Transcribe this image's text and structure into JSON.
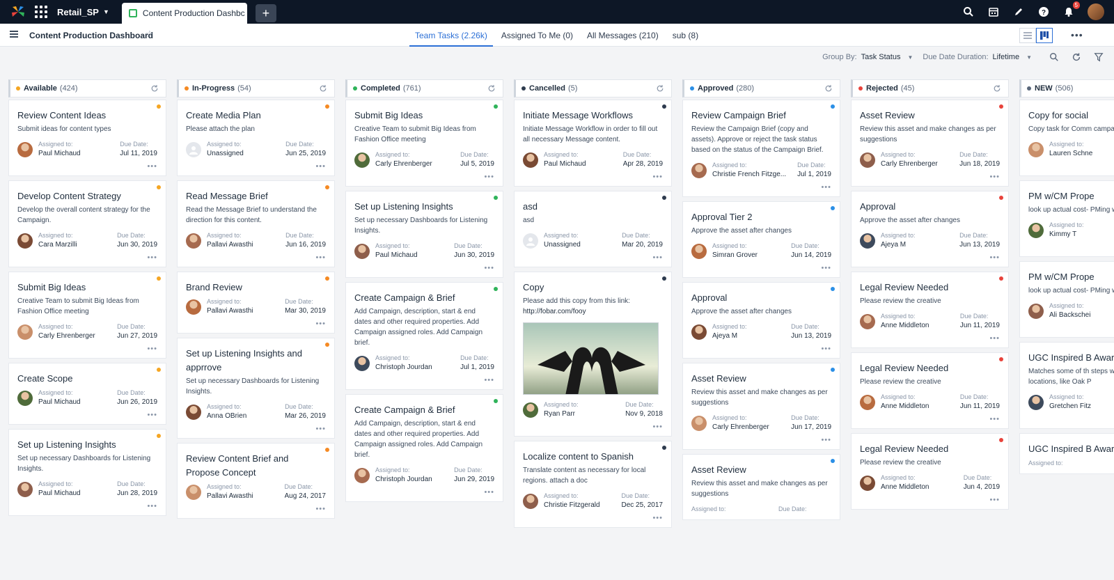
{
  "topbar": {
    "workspace": "Retail_SP",
    "active_tab": "Content Production Dashbc",
    "notification_count": "5",
    "icons": [
      "search-icon",
      "calendar-icon",
      "pencil-icon",
      "help-icon",
      "bell-icon"
    ]
  },
  "header": {
    "title": "Content Production Dashboard",
    "tabs": [
      "Team Tasks (2.26k)",
      "Assigned To Me (0)",
      "All Messages (210)",
      "sub (8)"
    ]
  },
  "filters": {
    "group_label": "Group By:",
    "group_value": "Task Status",
    "duration_label": "Due Date Duration:",
    "duration_value": "Lifetime"
  },
  "labels": {
    "assigned": "Assigned to:",
    "due": "Due Date:"
  },
  "colors": {
    "available": "#f5a623",
    "in_progress": "#f58a23",
    "completed": "#2fb35a",
    "cancelled": "#2e3b4e",
    "approved": "#2b8fe6",
    "rejected": "#e8433b",
    "new": "#5a677a"
  },
  "columns": [
    {
      "name": "Available",
      "count": "(424)",
      "color": "#f5a623",
      "cards": [
        {
          "title": "Review Content Ideas",
          "desc": "Submit ideas for content types",
          "assignee": "Paul Michaud",
          "due": "Jul 11, 2019"
        },
        {
          "title": "Develop Content Strategy",
          "desc": "Develop the overall content strategy for the Campaign.",
          "assignee": "Cara Marzilli",
          "due": "Jun 30, 2019"
        },
        {
          "title": "Submit Big Ideas",
          "desc": "Creative Team to submit Big Ideas from Fashion Office meeting",
          "assignee": "Carly Ehrenberger",
          "due": "Jun 27, 2019"
        },
        {
          "title": "Create Scope",
          "desc": "",
          "assignee": "Paul Michaud",
          "due": "Jun 26, 2019"
        },
        {
          "title": "Set up Listening Insights",
          "desc": "Set up necessary Dashboards for Listening Insights.",
          "assignee": "Paul Michaud",
          "due": "Jun 28, 2019"
        }
      ]
    },
    {
      "name": "In-Progress",
      "count": "(54)",
      "color": "#f58a23",
      "cards": [
        {
          "title": "Create Media Plan",
          "desc": "Please attach the plan",
          "assignee": "Unassigned",
          "due": "Jun 25, 2019"
        },
        {
          "title": "Read Message Brief",
          "desc": "Read the Message Brief to understand the direction for this content.",
          "assignee": "Pallavi Awasthi",
          "due": "Jun 16, 2019"
        },
        {
          "title": "Brand Review",
          "desc": "",
          "assignee": "Pallavi Awasthi",
          "due": "Mar 30, 2019"
        },
        {
          "title": "Set up Listening Insights and apprrove",
          "desc": "Set up necessary Dashboards for Listening Insights.",
          "assignee": "Anna OBrien",
          "due": "Mar 26, 2019"
        },
        {
          "title": "Review Content Brief and Propose Concept",
          "desc": "",
          "assignee": "Pallavi Awasthi",
          "due": "Aug 24, 2017"
        }
      ]
    },
    {
      "name": "Completed",
      "count": "(761)",
      "color": "#2fb35a",
      "cards": [
        {
          "title": "Submit Big Ideas",
          "desc": "Creative Team to submit Big Ideas from Fashion Office meeting",
          "assignee": "Carly Ehrenberger",
          "due": "Jul 5, 2019"
        },
        {
          "title": "Set up Listening Insights",
          "desc": "Set up necessary Dashboards for Listening Insights.",
          "assignee": "Paul Michaud",
          "due": "Jun 30, 2019"
        },
        {
          "title": "Create Campaign & Brief",
          "desc": "Add Campaign, description, start & end dates and other required properties. Add Campaign assigned roles. Add Campaign brief.",
          "assignee": "Christoph Jourdan",
          "due": "Jul 1, 2019"
        },
        {
          "title": "Create Campaign & Brief",
          "desc": "Add Campaign, description, start & end dates and other required properties. Add Campaign assigned roles. Add Campaign brief.",
          "assignee": "Christoph Jourdan",
          "due": "Jun 29, 2019"
        }
      ]
    },
    {
      "name": "Cancelled",
      "count": "(5)",
      "color": "#2e3b4e",
      "cards": [
        {
          "title": "Initiate Message Workflows",
          "desc": "Initiate Message Workflow in order to fill out all necessary Message content.",
          "assignee": "Paul Michaud",
          "due": "Apr 28, 2019"
        },
        {
          "title": "asd",
          "desc": "asd",
          "assignee": "Unassigned",
          "due": "Mar 20, 2019"
        },
        {
          "title": "Copy",
          "desc": "Please add this copy from this link:",
          "link": "http://fobar.com/fooy",
          "image": true,
          "assignee": "Ryan Parr",
          "due": "Nov 9, 2018"
        },
        {
          "title": "Localize content to Spanish",
          "desc": "Translate content as necessary for local regions. attach a doc",
          "assignee": "Christie Fitzgerald",
          "due": "Dec 25, 2017"
        }
      ]
    },
    {
      "name": "Approved",
      "count": "(280)",
      "color": "#2b8fe6",
      "cards": [
        {
          "title": "Review Campaign Brief",
          "desc": "Review the Campaign Brief (copy and assets). Approve or reject the task status based on the status of the Campaign Brief.",
          "assignee": "Christie French Fitzge...",
          "due": "Jul 1, 2019"
        },
        {
          "title": "Approval Tier 2",
          "desc": "Approve the asset after changes",
          "assignee": "Simran Grover",
          "due": "Jun 14, 2019"
        },
        {
          "title": "Approval",
          "desc": "Approve the asset after changes",
          "assignee": "Ajeya M",
          "due": "Jun 13, 2019"
        },
        {
          "title": "Asset Review",
          "desc": "Review this asset and make changes as per suggestions",
          "assignee": "Carly Ehrenberger",
          "due": "Jun 17, 2019"
        },
        {
          "title": "Asset Review",
          "desc": "Review this asset and make changes as per suggestions",
          "assignee": "",
          "due": ""
        }
      ]
    },
    {
      "name": "Rejected",
      "count": "(45)",
      "color": "#e8433b",
      "cards": [
        {
          "title": "Asset Review",
          "desc": "Review this asset and make changes as per suggestions",
          "assignee": "Carly Ehrenberger",
          "due": "Jun 18, 2019"
        },
        {
          "title": "Approval",
          "desc": "Approve the asset after changes",
          "assignee": "Ajeya M",
          "due": "Jun 13, 2019"
        },
        {
          "title": "Legal Review Needed",
          "desc": "Please review the creative",
          "assignee": "Anne Middleton",
          "due": "Jun 11, 2019"
        },
        {
          "title": "Legal Review Needed",
          "desc": "Please review the creative",
          "assignee": "Anne Middleton",
          "due": "Jun 11, 2019"
        },
        {
          "title": "Legal Review Needed",
          "desc": "Please review the creative",
          "assignee": "Anne Middleton",
          "due": "Jun 4, 2019"
        }
      ]
    },
    {
      "name": "NEW",
      "count": "(506)",
      "color": "#5a677a",
      "cards": [
        {
          "title": "Copy for social",
          "desc": "Copy task for Comm campaign",
          "assignee": "Lauren Schne",
          "due": ""
        },
        {
          "title": "PM w/CM Prope",
          "desc": "look up actual cost- PMing with CM",
          "assignee": "Kimmy T",
          "due": ""
        },
        {
          "title": "PM w/CM Prope",
          "desc": "look up actual cost- PMing with CM",
          "assignee": "Ali Backschei",
          "due": ""
        },
        {
          "title": "UGC Inspired B Awareness Con",
          "desc": "Matches some of th steps with mammog locations, like Oak P",
          "assignee": "Gretchen Fitz",
          "due": ""
        },
        {
          "title": "UGC Inspired B Awareness Con",
          "desc": "",
          "assignee": "",
          "due": ""
        }
      ]
    }
  ]
}
